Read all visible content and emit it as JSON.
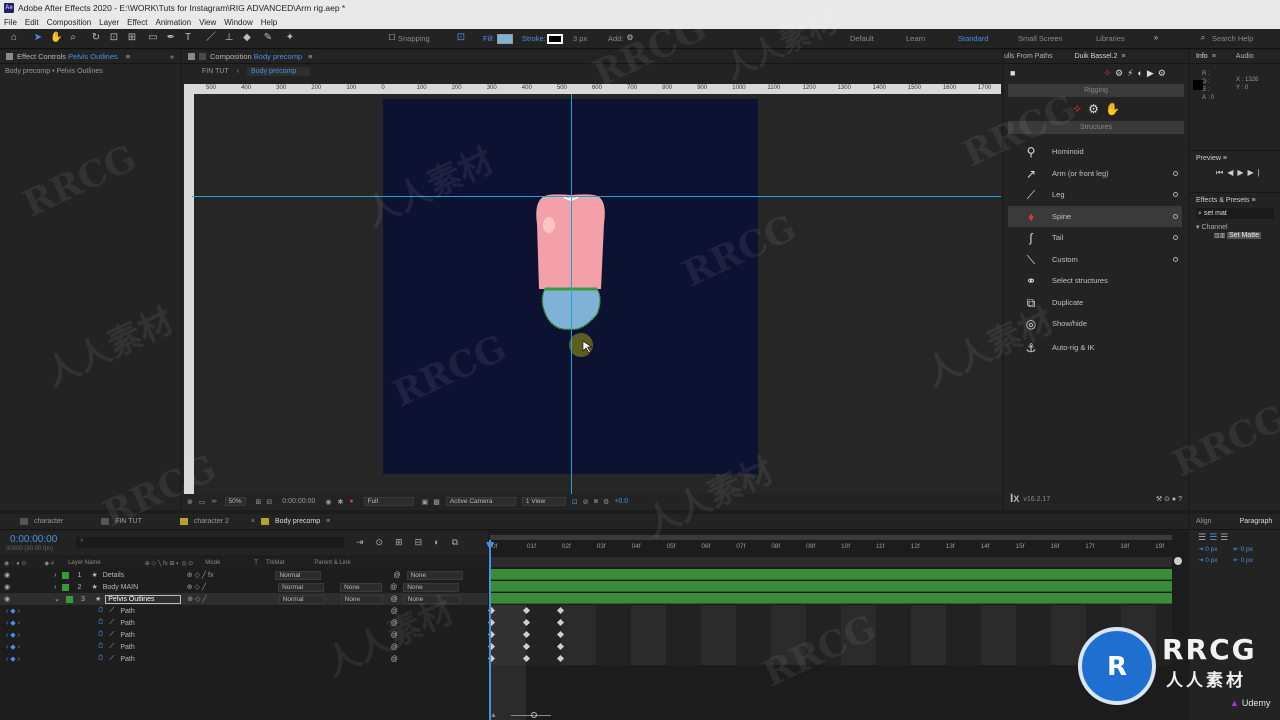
{
  "app": {
    "title": "Adobe After Effects 2020 - E:\\WORK\\Tuts for Instagram\\RIG ADVANCED\\Arm rig.aep *",
    "logo_text": "Ae"
  },
  "menu": [
    "File",
    "Edit",
    "Composition",
    "Layer",
    "Effect",
    "Animation",
    "View",
    "Window",
    "Help"
  ],
  "toolbar": {
    "snapping_label": "Snapping",
    "fill_label": "Fill:",
    "stroke_label": "Stroke:",
    "stroke_px": "3 px",
    "add_label": "Add:",
    "workspaces": [
      "Default",
      "Learn",
      "Standard",
      "Small Screen",
      "Libraries"
    ],
    "active_workspace": "Standard",
    "search_help": "Search Help"
  },
  "project_panel": {
    "tab_label": "Effect Controls",
    "tab_target": "Pelvis Outlines",
    "breadcrumb": "Body precomp • Pelvis Outlines"
  },
  "comp_panel": {
    "tab_label": "Composition",
    "tab_target": "Body precomp",
    "crumbs": [
      "FIN TUT",
      "Body precomp"
    ],
    "ruler_ticks": [
      "500",
      "400",
      "300",
      "200",
      "100",
      "0",
      "100",
      "200",
      "300",
      "400",
      "500",
      "600",
      "700",
      "800",
      "900",
      "1000",
      "1100",
      "1200",
      "1300",
      "1400",
      "1500",
      "1600",
      "1700"
    ],
    "bottom_bar": {
      "zoom": "50%",
      "timecode": "0:00:00:00",
      "resolution": "Full",
      "camera": "Active Camera",
      "views": "1 View",
      "offset": "+0.0"
    }
  },
  "right_top": {
    "tabs": [
      "ulls From Paths",
      "Duik Bassel.2"
    ],
    "info_tab": "Info",
    "audio_tab": "Audio",
    "rgba": [
      "R :",
      "G :",
      "B :",
      "A : 0"
    ],
    "coords": [
      "X : 1326",
      "Y : 0"
    ]
  },
  "duik": {
    "section_rigging": "Rigging",
    "section_structures": "Structures",
    "items": [
      {
        "label": "Hominoid",
        "icon": "hominoid-icon",
        "dot": false
      },
      {
        "label": "Arm (or front leg)",
        "icon": "arm-icon",
        "dot": true
      },
      {
        "label": "Leg",
        "icon": "leg-icon",
        "dot": true
      },
      {
        "label": "Spine",
        "icon": "spine-icon",
        "dot": true
      },
      {
        "label": "Tail",
        "icon": "tail-icon",
        "dot": true
      },
      {
        "label": "Custom",
        "icon": "custom-icon",
        "dot": true
      },
      {
        "label": "Select structures",
        "icon": "select-icon",
        "dot": false
      },
      {
        "label": "Duplicate",
        "icon": "duplicate-icon",
        "dot": false
      },
      {
        "label": "Show/hide",
        "icon": "show-hide-icon",
        "dot": false
      },
      {
        "label": "Auto-rig & IK",
        "icon": "autorig-icon",
        "dot": false
      }
    ],
    "selected": "Spine",
    "version": "v16.2.17"
  },
  "preview_panel": {
    "title": "Preview"
  },
  "effects_panel": {
    "title": "Effects & Presets",
    "search_value": "set mat",
    "category": "Channel",
    "result": "Set Matte"
  },
  "align_panel": {
    "tabs": [
      "Align",
      "Paragraph"
    ],
    "fields": [
      "0 px",
      "0 px",
      "0 px",
      "0 px",
      "0 px"
    ]
  },
  "timeline": {
    "tabs": [
      "character",
      "FIN TUT",
      "character 2",
      "Body precomp"
    ],
    "active_tab": "Body precomp",
    "timecode": "0:00:00:00",
    "timecode_sub": "00000 (30.00 fps)",
    "search_placeholder": "",
    "headers": {
      "layer_name": "Layer Name",
      "mode": "Mode",
      "t": "T",
      "trkmat": "TrkMat",
      "parent": "Parent & Link"
    },
    "layers": [
      {
        "num": "1",
        "name": "Details",
        "mode": "Normal",
        "trkmat": "",
        "parent": "None"
      },
      {
        "num": "2",
        "name": "Body MAIN",
        "mode": "Normal",
        "trkmat": "None",
        "parent": "None"
      },
      {
        "num": "3",
        "name": "Pelvis Outlines",
        "mode": "Normal",
        "trkmat": "None",
        "parent": "None"
      }
    ],
    "paths": [
      "Path",
      "Path",
      "Path",
      "Path",
      "Path"
    ],
    "frames": [
      "0f",
      "01f",
      "02f",
      "03f",
      "04f",
      "05f",
      "06f",
      "07f",
      "08f",
      "09f",
      "10f",
      "11f",
      "12f",
      "13f",
      "14f",
      "15f",
      "16f",
      "17f",
      "18f",
      "19f"
    ]
  },
  "watermark": {
    "text_latin": "RRCG",
    "text_cn": "人人素材",
    "logo_title": "RRCG",
    "logo_sub": "人人素材",
    "udemy": "Udemy"
  },
  "colors": {
    "accent": "#4a90e2",
    "comp_bg": "#0d1232",
    "guide": "#1fa3d9",
    "torso": "#f4a0a8",
    "pelvis": "#7fb2d6",
    "pelvis_outline": "#3a9a3a",
    "layer_bar": "#3a8c3a"
  }
}
